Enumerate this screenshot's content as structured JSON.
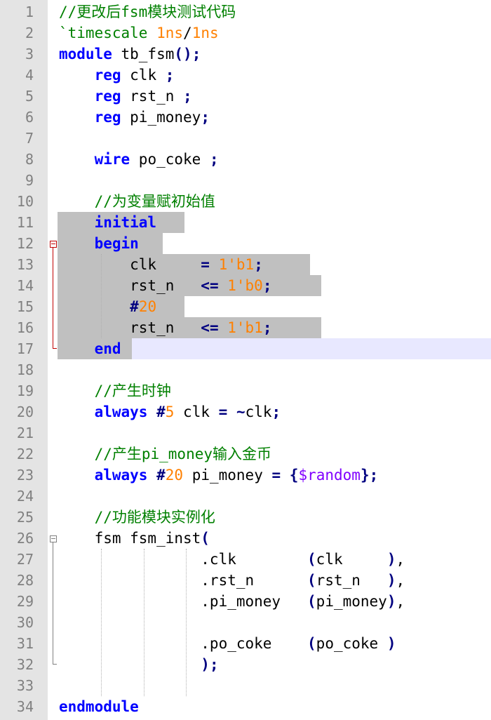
{
  "editor": {
    "lines": [
      {
        "n": "1",
        "text": "//更改后fsm模块测试代码"
      },
      {
        "n": "2",
        "text": "`timescale 1ns/1ns"
      },
      {
        "n": "3",
        "text": "module tb_fsm();"
      },
      {
        "n": "4",
        "text": "    reg clk ;"
      },
      {
        "n": "5",
        "text": "    reg rst_n ;"
      },
      {
        "n": "6",
        "text": "    reg pi_money;"
      },
      {
        "n": "7",
        "text": ""
      },
      {
        "n": "8",
        "text": "    wire po_coke ;"
      },
      {
        "n": "9",
        "text": ""
      },
      {
        "n": "10",
        "text": "    //为变量赋初始值"
      },
      {
        "n": "11",
        "text": "    initial"
      },
      {
        "n": "12",
        "text": "    begin"
      },
      {
        "n": "13",
        "text": "        clk     = 1'b1;"
      },
      {
        "n": "14",
        "text": "        rst_n   <= 1'b0;"
      },
      {
        "n": "15",
        "text": "        #20"
      },
      {
        "n": "16",
        "text": "        rst_n   <= 1'b1;"
      },
      {
        "n": "17",
        "text": "    end"
      },
      {
        "n": "18",
        "text": ""
      },
      {
        "n": "19",
        "text": "    //产生时钟"
      },
      {
        "n": "20",
        "text": "    always #5 clk = ~clk;"
      },
      {
        "n": "21",
        "text": ""
      },
      {
        "n": "22",
        "text": "    //产生pi_money输入金币"
      },
      {
        "n": "23",
        "text": "    always #20 pi_money = {$random};"
      },
      {
        "n": "24",
        "text": ""
      },
      {
        "n": "25",
        "text": "    //功能模块实例化"
      },
      {
        "n": "26",
        "text": "    fsm fsm_inst("
      },
      {
        "n": "27",
        "text": "                .clk        (clk     ),"
      },
      {
        "n": "28",
        "text": "                .rst_n      (rst_n   ),"
      },
      {
        "n": "29",
        "text": "                .pi_money   (pi_money),"
      },
      {
        "n": "30",
        "text": ""
      },
      {
        "n": "31",
        "text": "                .po_coke    (po_coke )"
      },
      {
        "n": "32",
        "text": "                );"
      },
      {
        "n": "33",
        "text": ""
      },
      {
        "n": "34",
        "text": "endmodule"
      }
    ]
  },
  "colors": {
    "keyword": "#0000ff",
    "comment": "#008000",
    "number": "#ff8000",
    "operator": "#000080",
    "system_task": "#8000ff",
    "selection": "#c0c0c0",
    "caret_line": "#e8e8ff",
    "gutter": "#e4e4e4"
  }
}
